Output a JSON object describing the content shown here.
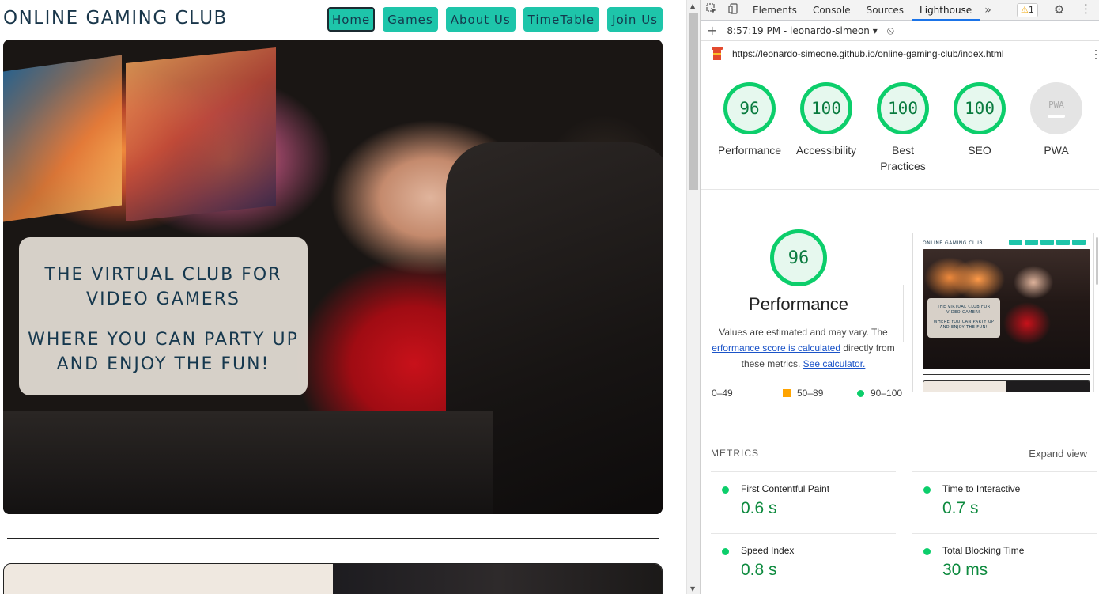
{
  "site": {
    "logo": "ONLINE GAMING CLUB",
    "nav": [
      {
        "label": "Home",
        "active": true
      },
      {
        "label": "Games",
        "active": false
      },
      {
        "label": "About Us",
        "active": false
      },
      {
        "label": "TimeTable",
        "active": false
      },
      {
        "label": "Join Us",
        "active": false
      }
    ],
    "hero": {
      "line1": "THE VIRTUAL CLUB FOR",
      "line2": "VIDEO GAMERS",
      "line3": "WHERE YOU CAN PARTY UP",
      "line4": "AND ENJOY THE FUN!"
    },
    "accent_color": "#1ec5aa",
    "text_color": "#16384e"
  },
  "devtools": {
    "tabs": [
      "Elements",
      "Console",
      "Sources",
      "Lighthouse"
    ],
    "active_tab": "Lighthouse",
    "more": "»",
    "warning_count": "1",
    "report_selector": "8:57:19 PM - leonardo-simeon",
    "url": "https://leonardo-simeone.github.io/online-gaming-club/index.html",
    "scores": [
      {
        "label": "Performance",
        "value": "96"
      },
      {
        "label": "Accessibility",
        "value": "100"
      },
      {
        "label": "Best Practices",
        "value": "100"
      },
      {
        "label": "SEO",
        "value": "100"
      },
      {
        "label": "PWA",
        "value": "PWA"
      }
    ],
    "performance": {
      "score": "96",
      "title": "Performance",
      "desc_start": "Values are estimated and may vary. The",
      "desc_link": "erformance score is calculated",
      "desc_mid": "directly from these metrics.",
      "desc_calc": "See calculator."
    },
    "legend": [
      "0–49",
      "50–89",
      "90–100"
    ],
    "thumbnail": {
      "logo": "ONLINE GAMING CLUB",
      "line1": "THE VIRTUAL CLUB FOR",
      "line2": "VIDEO GAMERS",
      "line3": "WHERE YOU CAN PARTY UP",
      "line4": "AND ENJOY THE FUN!"
    },
    "metrics_header": "METRICS",
    "expand_label": "Expand view",
    "metrics": [
      {
        "name": "First Contentful Paint",
        "value": "0.6 s"
      },
      {
        "name": "Time to Interactive",
        "value": "0.7 s"
      },
      {
        "name": "Speed Index",
        "value": "0.8 s"
      },
      {
        "name": "Total Blocking Time",
        "value": "30 ms"
      }
    ],
    "pass_color": "#0cce6b",
    "average_color": "#ffa400"
  }
}
